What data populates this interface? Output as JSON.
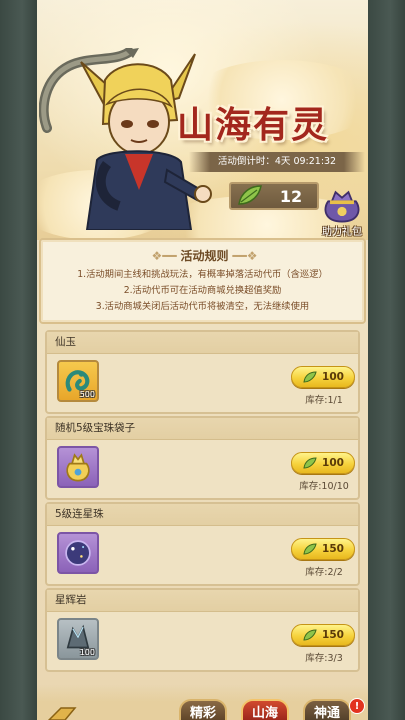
{
  "event": {
    "title": "山海有灵",
    "countdown": "活动倒计时：4天 09:21:32",
    "token_count": "12",
    "gift_label": "助力礼包"
  },
  "rules": {
    "title": "活动规则",
    "lines": [
      "1.活动期间主线和挑战玩法，有概率掉落活动代币（含巡逻）",
      "2.活动代币可在活动商城兑换超值奖励",
      "3.活动商城关闭后活动代币将被清空，无法继续使用"
    ]
  },
  "items": [
    {
      "name": "仙玉",
      "qty": "500",
      "price": "100",
      "stock": "库存:1/1",
      "icon": "jade-dragon-icon"
    },
    {
      "name": "随机5级宝珠袋子",
      "qty": "",
      "price": "100",
      "stock": "库存:10/10",
      "icon": "gem-bag-icon"
    },
    {
      "name": "5级连星珠",
      "qty": "",
      "price": "150",
      "stock": "库存:2/2",
      "icon": "star-orb-icon"
    },
    {
      "name": "星辉岩",
      "qty": "100",
      "price": "150",
      "stock": "库存:3/3",
      "icon": "star-rock-icon"
    }
  ],
  "tabs": [
    {
      "label": "精彩"
    },
    {
      "label": "山海"
    },
    {
      "label": "神通"
    }
  ],
  "badge": "!",
  "colors": {
    "accent": "#a3271d",
    "button": "#f6d23d",
    "panel": "#efe2c3"
  }
}
